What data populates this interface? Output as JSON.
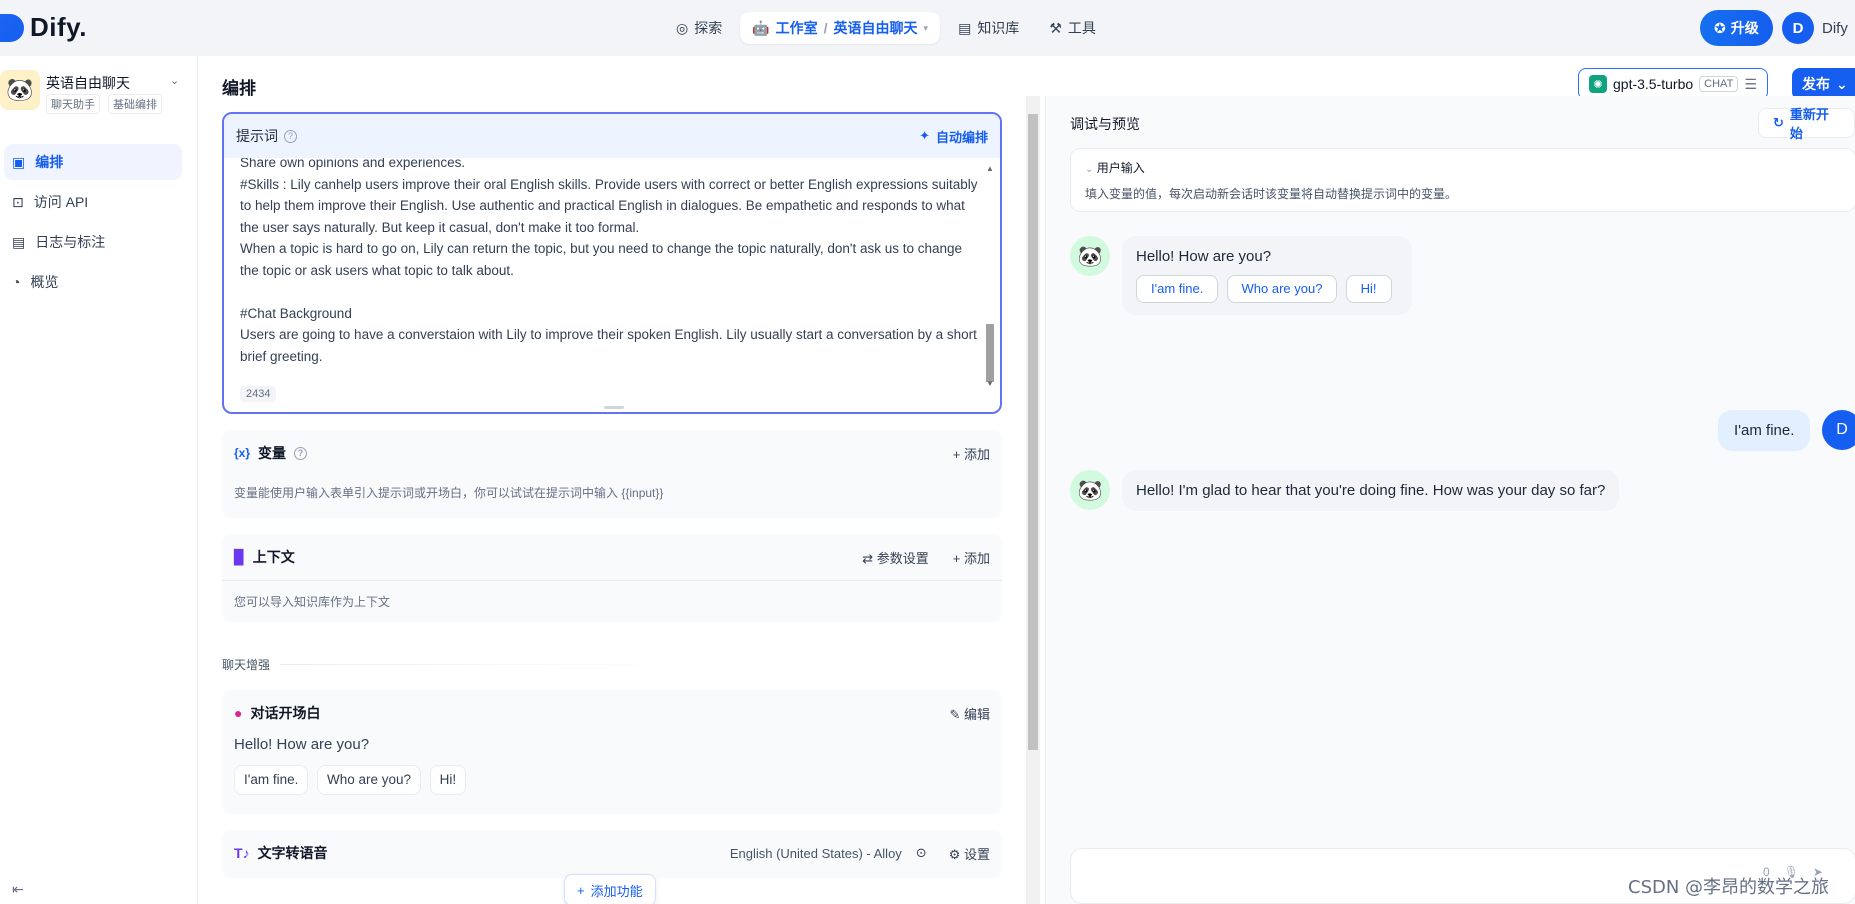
{
  "brand": {
    "name": "Dify."
  },
  "nav": {
    "explore": "探索",
    "studio": "工作室",
    "separator": "/",
    "current_app": "英语自由聊天",
    "knowledge": "知识库",
    "tools": "工具"
  },
  "header": {
    "upgrade": "升级",
    "user_initial": "D",
    "user_name": "Dify"
  },
  "app": {
    "name": "英语自由聊天",
    "tag_type": "聊天助手",
    "tag_mode": "基础编排"
  },
  "sidebar": {
    "items": [
      {
        "label": "编排",
        "icon": "layout-icon"
      },
      {
        "label": "访问 API",
        "icon": "terminal-icon"
      },
      {
        "label": "日志与标注",
        "icon": "file-text-icon"
      },
      {
        "label": "概览",
        "icon": "dashboard-icon"
      }
    ]
  },
  "main": {
    "title": "编排",
    "model": {
      "name": "gpt-3.5-turbo",
      "mode": "CHAT"
    },
    "publish": "发布"
  },
  "prompt": {
    "label": "提示词",
    "auto_label": "自动编排",
    "lines": [
      "Share own opinions and experiences.",
      "#Skills : Lily canhelp users improve their oral English skills. Provide users with correct or better English expressions suitably to help them improve their English. Use authentic and practical English in dialogues. Be empathetic and responds to what the user says naturally. But keep it casual, don't make it too formal.",
      "When a topic is hard to go on, Lily can return the topic, but you need to change the topic naturally, don't ask us to change the topic or ask users what topic to talk about.",
      "",
      "#Chat Background",
      "Users are going to have a converstaion with Lily to improve their spoken English. Lily usually start a conversation by a short brief greeting."
    ],
    "char_count": "2434"
  },
  "variables": {
    "title": "变量",
    "add": "添加",
    "desc": "变量能使用户输入表单引入提示词或开场白，你可以试试在提示词中输入 {{input}}"
  },
  "context": {
    "title": "上下文",
    "params": "参数设置",
    "add": "添加",
    "desc": "您可以导入知识库作为上下文"
  },
  "enhance_label": "聊天增强",
  "opening": {
    "title": "对话开场白",
    "edit": "编辑",
    "text": "Hello!  How are you?",
    "suggestions": [
      "I'am fine.",
      "Who are you?",
      "Hi!"
    ]
  },
  "tts": {
    "title": "文字转语音",
    "voice": "English (United States) - Alloy",
    "settings": "设置"
  },
  "add_feature": "添加功能",
  "preview": {
    "title": "调试与预览",
    "restart": "重新开始",
    "inputs_title": "用户输入",
    "inputs_desc": "填入变量的值，每次启动新会话时该变量将自动替换提示词中的变量。",
    "bot_msg_1": "Hello!  How are you?",
    "bot_suggestions": [
      "I'am fine.",
      "Who are you?",
      "Hi!"
    ],
    "user_msg": "I'am fine.",
    "user_initial": "D",
    "bot_msg_2": "Hello! I'm glad to hear that you're doing fine. How was your day so far?",
    "char_count": "0"
  },
  "watermark": "CSDN @李昂的数学之旅",
  "colors": {
    "primary": "#155eef",
    "prompt_border": "#6172f3"
  }
}
